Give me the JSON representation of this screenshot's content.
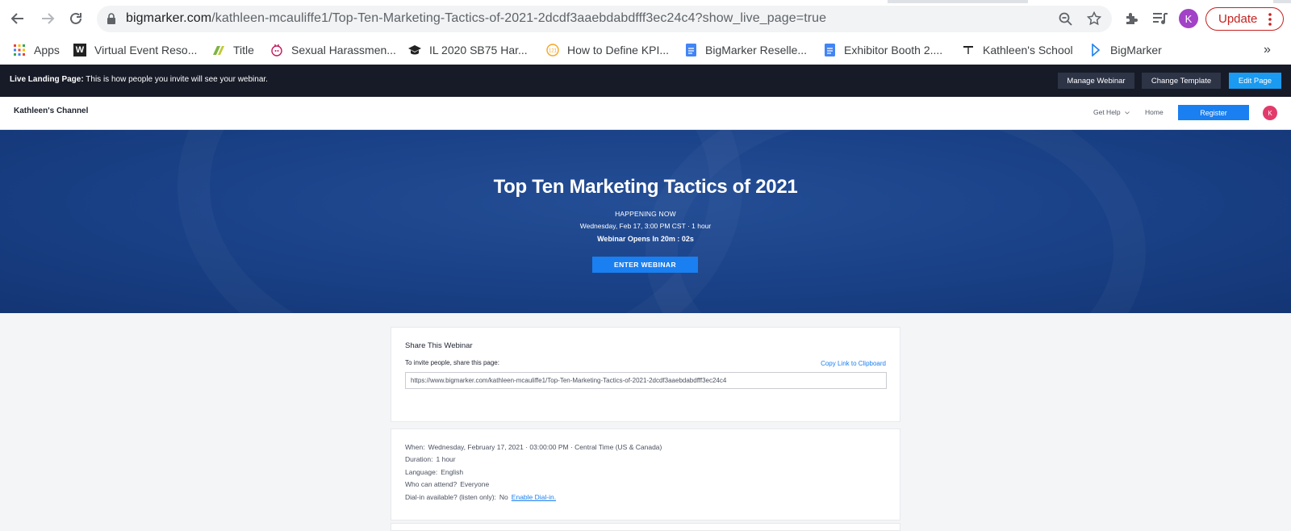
{
  "browser": {
    "url_host": "bigmarker.com",
    "url_path": "/kathleen-mcauliffe1/Top-Ten-Marketing-Tactics-of-2021-2dcdf3aaebdabdfff3ec24c4?show_live_page=true",
    "profile_initial": "K",
    "update_label": "Update",
    "icons": [
      "back-arrow-icon",
      "forward-arrow-icon",
      "reload-icon",
      "lock-icon",
      "zoom-icon",
      "star-icon",
      "extensions-icon",
      "media-icon",
      "kebab-menu-icon"
    ],
    "bookmarks": [
      {
        "label": "Apps",
        "icon": "apps-grid-icon"
      },
      {
        "label": "Virtual Event Reso...",
        "icon": "w-logo-icon"
      },
      {
        "label": "Title",
        "icon": "title-logo-icon"
      },
      {
        "label": "Sexual Harassmen...",
        "icon": "bunny-logo-icon"
      },
      {
        "label": "IL 2020 SB75 Har...",
        "icon": "graduation-cap-icon"
      },
      {
        "label": "How to Define KPI...",
        "icon": "kpi-logo-icon"
      },
      {
        "label": "BigMarker Reselle...",
        "icon": "doc-icon"
      },
      {
        "label": "Exhibitor Booth 2....",
        "icon": "doc-icon"
      },
      {
        "label": "Kathleen's School",
        "icon": "school-logo-icon"
      },
      {
        "label": "BigMarker",
        "icon": "bigmarker-logo-icon"
      }
    ],
    "overflow_label": "»"
  },
  "banner": {
    "label_bold": "Live Landing Page:",
    "label_text": " This is how people you invite will see your webinar.",
    "manage_label": "Manage Webinar",
    "change_template_label": "Change Template",
    "edit_page_label": "Edit Page",
    "edit_color": "#1a9af0"
  },
  "channel": {
    "name": "Kathleen's Channel",
    "get_help_label": "Get Help",
    "home_label": "Home",
    "register_label": "Register",
    "avatar_initial": "K"
  },
  "hero": {
    "title": "Top Ten Marketing Tactics of 2021",
    "status": "HAPPENING NOW",
    "datetime": "Wednesday, Feb 17, 3:00 PM CST · 1 hour",
    "countdown": "Webinar Opens In 20m : 02s",
    "enter_label": "ENTER WEBINAR"
  },
  "share": {
    "title": "Share This Webinar",
    "subtitle": "To invite people, share this page:",
    "copy_label": "Copy Link to Clipboard",
    "url": "https://www.bigmarker.com/kathleen-mcauliffe1/Top-Ten-Marketing-Tactics-of-2021-2dcdf3aaebdabdfff3ec24c4"
  },
  "details": {
    "when_label": "When:",
    "when_value": "Wednesday, February 17, 2021 · 03:00:00 PM · Central Time (US & Canada)",
    "duration_label": "Duration:",
    "duration_value": "1 hour",
    "language_label": "Language:",
    "language_value": "English",
    "attend_label": "Who can attend?",
    "attend_value": "Everyone",
    "dialin_label": "Dial-in available? (listen only):",
    "dialin_value": "No",
    "enable_dialin_label": "Enable Dial-in."
  }
}
